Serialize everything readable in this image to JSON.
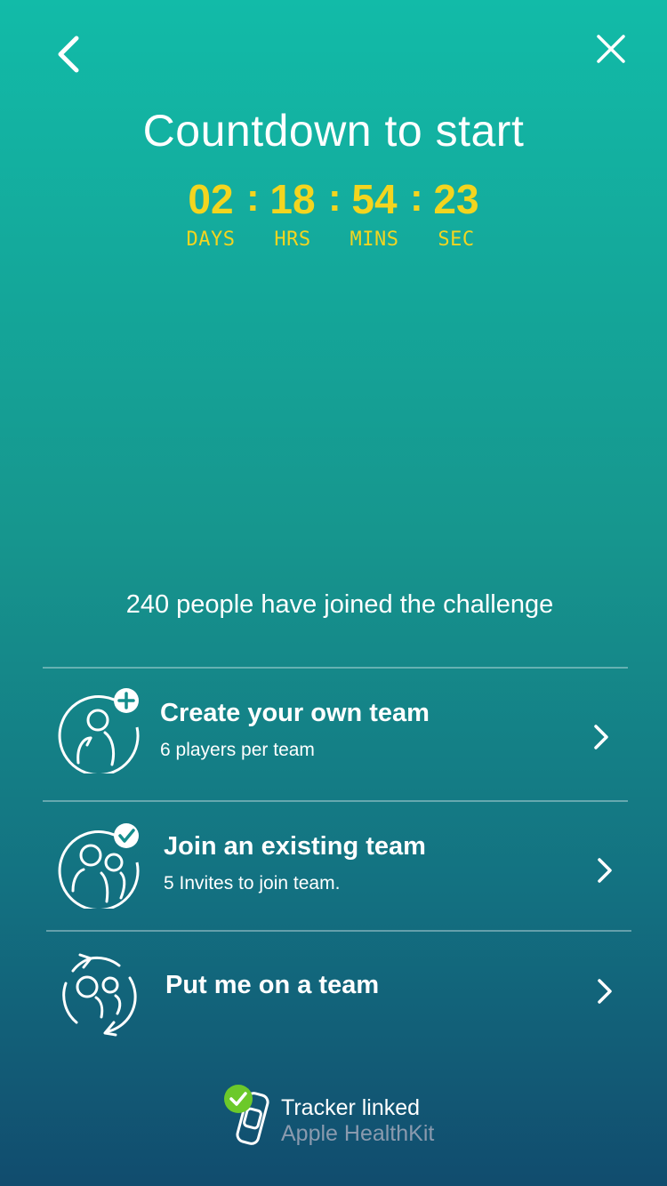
{
  "header": {
    "back_icon": "chevron-left-icon",
    "close_icon": "close-icon",
    "title": "Countdown to start"
  },
  "countdown": {
    "days": "02",
    "hours": "18",
    "minutes": "54",
    "seconds": "23",
    "separator": ":",
    "days_label": "DAYS",
    "hours_label": "HRS",
    "minutes_label": "MINS",
    "seconds_label": "SEC",
    "color": "#f3d51f"
  },
  "joined_text": "240 people have joined the challenge",
  "options": [
    {
      "icon": "create-team-icon",
      "title": "Create your own team",
      "subtitle": "6 players per team"
    },
    {
      "icon": "join-team-icon",
      "title": "Join an existing team",
      "subtitle": "5 Invites to join team."
    },
    {
      "icon": "auto-assign-team-icon",
      "title": "Put me on a team",
      "subtitle": ""
    }
  ],
  "tracker": {
    "icon": "tracker-linked-icon",
    "status": "Tracker linked",
    "source": "Apple HealthKit",
    "check_color": "#6cc92a"
  }
}
